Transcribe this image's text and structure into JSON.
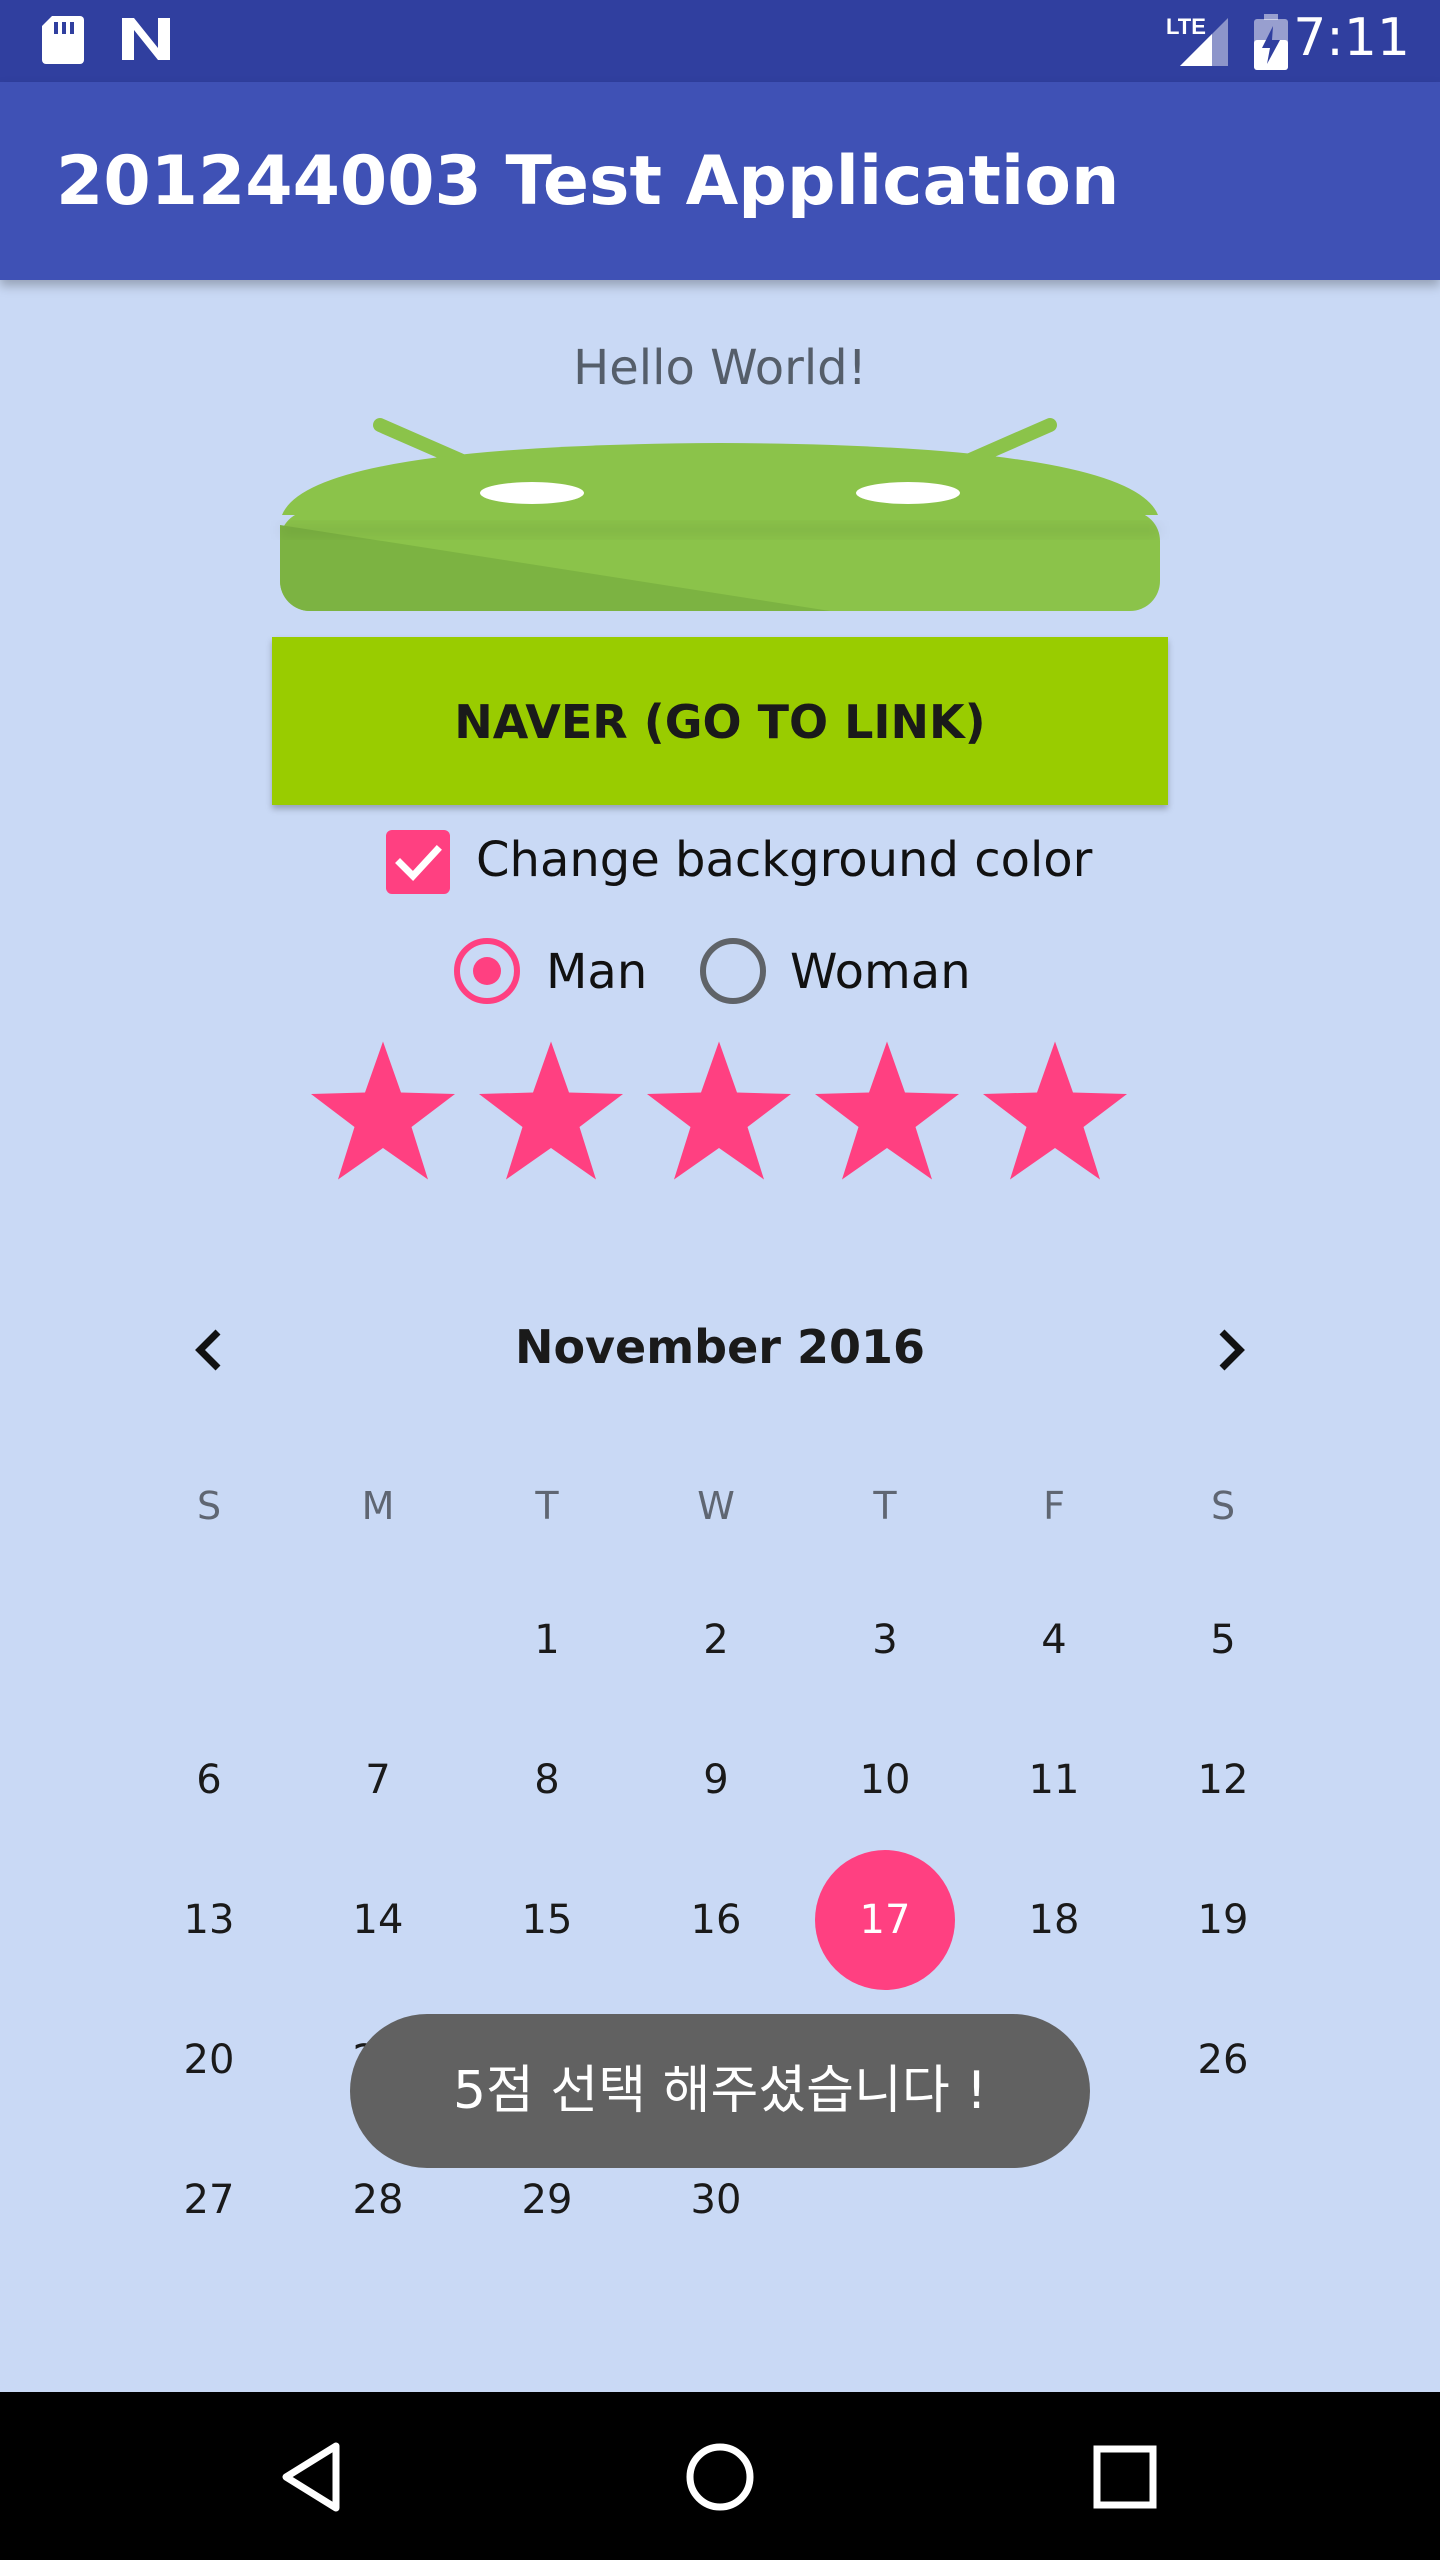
{
  "status_bar": {
    "time": "7:11",
    "network_label": "LTE",
    "icons": [
      "sd-card-icon",
      "n-notification-icon",
      "lte-signal-icon",
      "battery-charging-icon"
    ]
  },
  "app_bar": {
    "title": "201244003 Test Application"
  },
  "main": {
    "hello": "Hello World!",
    "image": "android-logo",
    "link_button": "NAVER (GO TO LINK)",
    "checkbox": {
      "label": "Change background color",
      "checked": true
    },
    "radios": [
      {
        "label": "Man",
        "selected": true
      },
      {
        "label": "Woman",
        "selected": false
      }
    ],
    "rating": {
      "value": 5,
      "max": 5
    }
  },
  "calendar": {
    "month_label": "November 2016",
    "weekdays": [
      "S",
      "M",
      "T",
      "W",
      "T",
      "F",
      "S"
    ],
    "first_weekday_index": 2,
    "days_in_month": 30,
    "selected_day": 17
  },
  "toast": {
    "message": "5점 선택 해주셨습니다 !"
  },
  "colors": {
    "status_bar": "#303f9f",
    "app_bar": "#3f51b5",
    "background": "#c9d9f5",
    "accent": "#ff4081",
    "button": "#99cc00",
    "android_green": "#8bc34a"
  },
  "nav_bar": {
    "buttons": [
      "back-icon",
      "home-icon",
      "recents-icon"
    ]
  }
}
